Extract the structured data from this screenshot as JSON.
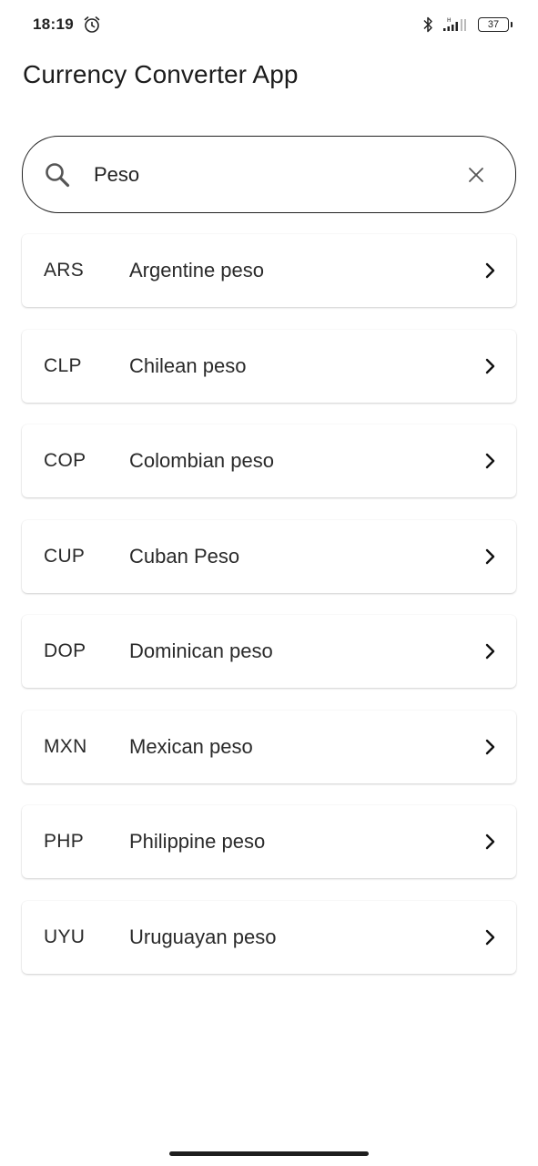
{
  "status_bar": {
    "time": "18:19",
    "battery": "37",
    "icons": [
      "alarm-icon",
      "bluetooth-icon",
      "signal-icon",
      "battery-icon"
    ]
  },
  "header": {
    "title": "Currency Converter App"
  },
  "search": {
    "value": "Peso",
    "icon": "search-icon",
    "clear_icon": "close-icon"
  },
  "currencies": [
    {
      "code": "ARS",
      "name": "Argentine peso"
    },
    {
      "code": "CLP",
      "name": "Chilean peso"
    },
    {
      "code": "COP",
      "name": "Colombian peso"
    },
    {
      "code": "CUP",
      "name": "Cuban Peso"
    },
    {
      "code": "DOP",
      "name": "Dominican peso"
    },
    {
      "code": "MXN",
      "name": "Mexican peso"
    },
    {
      "code": "PHP",
      "name": "Philippine peso"
    },
    {
      "code": "UYU",
      "name": "Uruguayan peso"
    }
  ],
  "colors": {
    "background": "#ffffff",
    "text": "#1c1c1c",
    "border": "#222222"
  }
}
